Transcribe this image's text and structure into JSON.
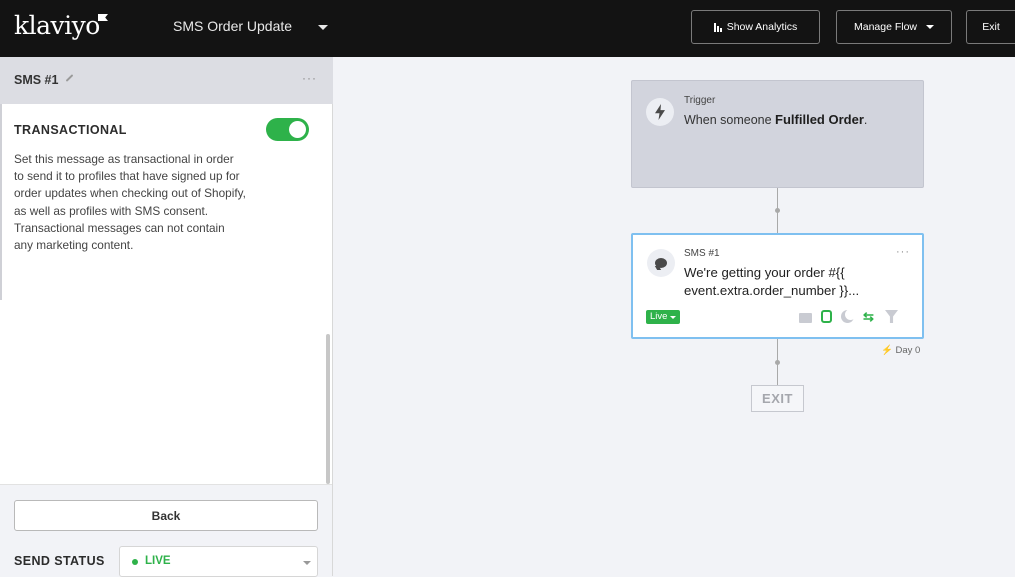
{
  "header": {
    "logo_text": "klaviyo",
    "flow_title": "SMS Order Update",
    "show_analytics_label": "Show Analytics",
    "manage_flow_label": "Manage Flow",
    "exit_label": "Exit"
  },
  "panel": {
    "title": "SMS #1",
    "more_label": "···",
    "transactional_label": "TRANSACTIONAL",
    "transactional_enabled": true,
    "transactional_description": "Set this message as transactional in order to send it to profiles that have signed up for order updates when checking out of Shopify, as well as profiles with SMS consent. Transactional messages can not contain any marketing content.",
    "back_label": "Back",
    "send_status_label": "SEND STATUS",
    "send_status_value": "LIVE"
  },
  "canvas": {
    "trigger": {
      "label": "Trigger",
      "text_prefix": "When someone ",
      "event": "Fulfilled Order",
      "text_suffix": "."
    },
    "sms_card": {
      "label": "SMS #1",
      "more_label": "···",
      "message_preview": "We're getting your order #{{ event.extra.order_number }}...",
      "status_badge": "Live",
      "icons": [
        "envelope-icon",
        "phone-icon",
        "moon-icon",
        "split-icon",
        "filter-icon"
      ]
    },
    "delay_label": "Day 0",
    "exit_label": "EXIT"
  },
  "colors": {
    "accent_green": "#2eb24a",
    "header_bg": "#131313",
    "selected_border": "#7fc0f0"
  }
}
